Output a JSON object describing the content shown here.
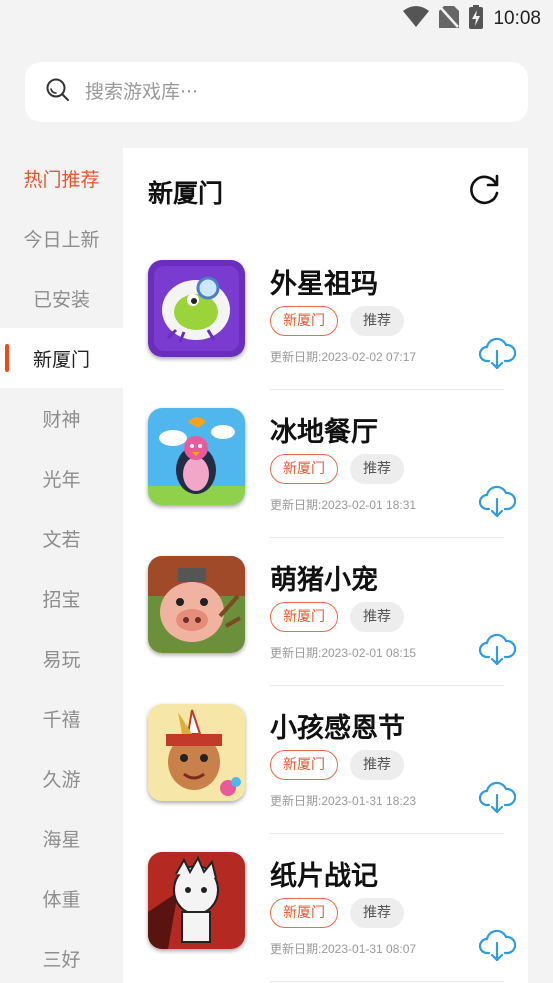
{
  "status_bar": {
    "time": "10:08",
    "icons": [
      "wifi-icon",
      "no-sim-icon",
      "battery-charging-icon"
    ]
  },
  "search": {
    "placeholder": "搜索游戏库···",
    "icon": "search-icon"
  },
  "sidebar": {
    "active_index": 3,
    "items": [
      {
        "label": "热门推荐"
      },
      {
        "label": "今日上新"
      },
      {
        "label": "已安装"
      },
      {
        "label": "新厦门"
      },
      {
        "label": "财神"
      },
      {
        "label": "光年"
      },
      {
        "label": "文若"
      },
      {
        "label": "招宝"
      },
      {
        "label": "易玩"
      },
      {
        "label": "千禧"
      },
      {
        "label": "久游"
      },
      {
        "label": "海星"
      },
      {
        "label": "体重"
      },
      {
        "label": "三好"
      }
    ]
  },
  "panel": {
    "title": "新厦门",
    "refresh_icon": "refresh-icon"
  },
  "games": [
    {
      "name": "外星祖玛",
      "tags": [
        "新厦门",
        "推荐"
      ],
      "update": "更新日期:2023-02-02 07:17"
    },
    {
      "name": "冰地餐厅",
      "tags": [
        "新厦门",
        "推荐"
      ],
      "update": "更新日期:2023-02-01 18:31"
    },
    {
      "name": "萌猪小宠",
      "tags": [
        "新厦门",
        "推荐"
      ],
      "update": "更新日期:2023-02-01 08:15"
    },
    {
      "name": "小孩感恩节",
      "tags": [
        "新厦门",
        "推荐"
      ],
      "update": "更新日期:2023-01-31 18:23"
    },
    {
      "name": "纸片战记",
      "tags": [
        "新厦门",
        "推荐"
      ],
      "update": "更新日期:2023-01-31 08:07"
    }
  ],
  "colors": {
    "accent": "#e8562d",
    "download": "#2f9be0",
    "background": "#f3f3f3"
  }
}
